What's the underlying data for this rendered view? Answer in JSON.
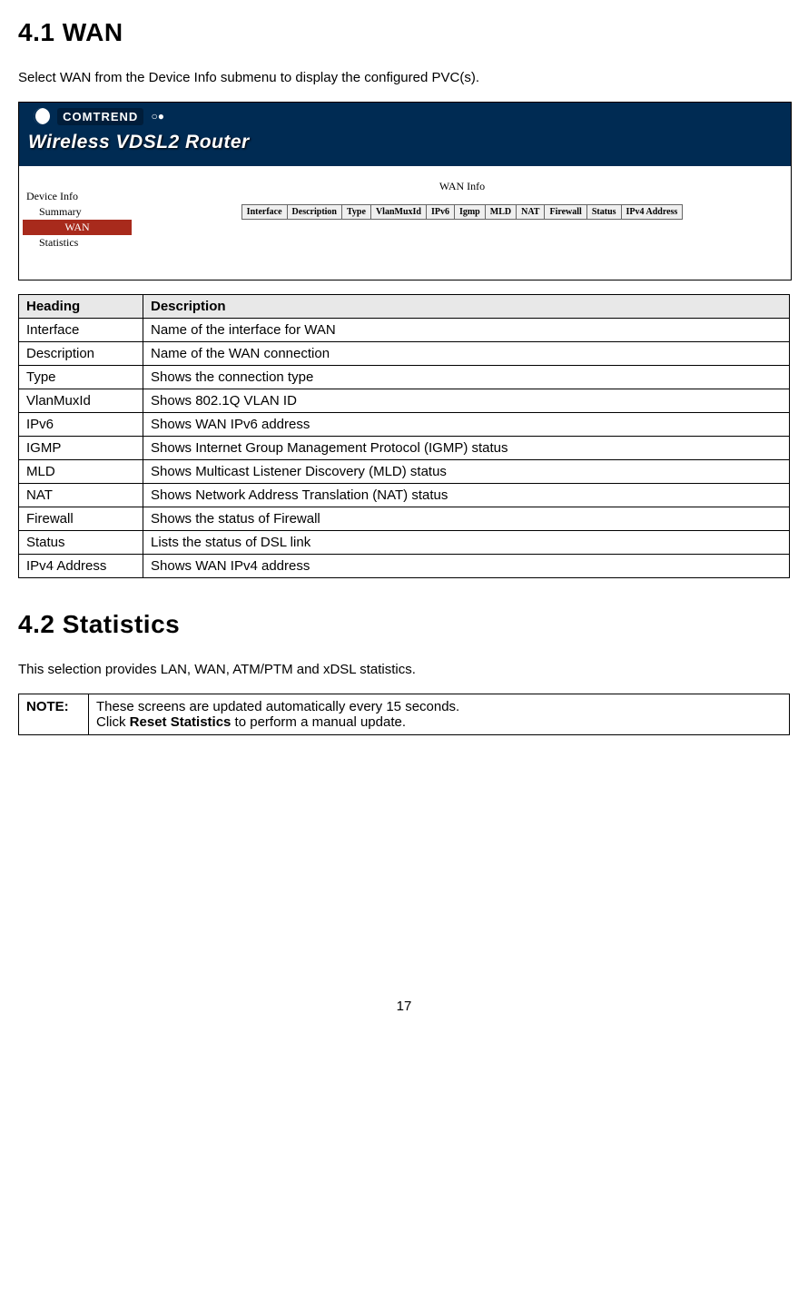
{
  "sections": {
    "s1": {
      "number": "4.1",
      "title": "WAN",
      "intro": "Select WAN from the Device Info submenu to display the configured PVC(s)."
    },
    "s2": {
      "number": "4.2",
      "title": "Statistics",
      "intro": "This selection provides LAN, WAN, ATM/PTM and xDSL statistics."
    }
  },
  "screenshot": {
    "brand": "COMTREND",
    "router_model": "Wireless VDSL2 Router",
    "menu": {
      "parent": "Device Info",
      "child1": "Summary",
      "selected": "WAN",
      "child3": "Statistics"
    },
    "pane_title": "WAN Info",
    "columns": [
      "Interface",
      "Description",
      "Type",
      "VlanMuxId",
      "IPv6",
      "Igmp",
      "MLD",
      "NAT",
      "Firewall",
      "Status",
      "IPv4 Address"
    ]
  },
  "desc_table": {
    "head_heading": "Heading",
    "head_desc": "Description",
    "rows": [
      {
        "h": "Interface",
        "d": "Name of the interface for WAN"
      },
      {
        "h": "Description",
        "d": "Name of the WAN connection"
      },
      {
        "h": "Type",
        "d": "Shows the connection type"
      },
      {
        "h": "VlanMuxId",
        "d": "Shows 802.1Q VLAN ID"
      },
      {
        "h": "IPv6",
        "d": "Shows WAN IPv6 address"
      },
      {
        "h": "IGMP",
        "d": "Shows Internet Group Management Protocol (IGMP) status"
      },
      {
        "h": "MLD",
        "d": "Shows Multicast Listener Discovery (MLD) status"
      },
      {
        "h": "NAT",
        "d": "Shows Network Address Translation (NAT) status"
      },
      {
        "h": "Firewall",
        "d": "Shows the status of Firewall"
      },
      {
        "h": "Status",
        "d": "Lists the status of DSL link"
      },
      {
        "h": "IPv4 Address",
        "d": "Shows WAN IPv4 address"
      }
    ]
  },
  "note": {
    "label": "NOTE:",
    "line1": "These screens are updated automatically every 15 seconds.",
    "line2a": "Click ",
    "line2_bold": "Reset Statistics",
    "line2b": " to perform a manual update."
  },
  "page_number": "17"
}
